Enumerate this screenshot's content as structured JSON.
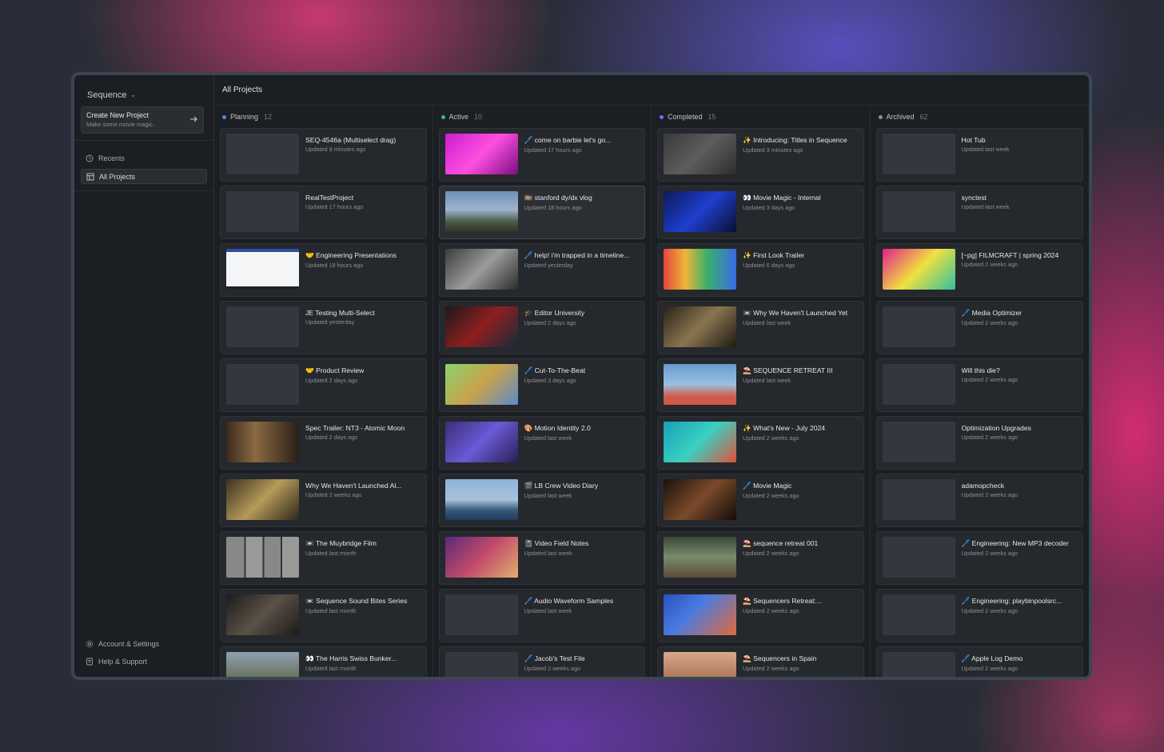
{
  "sidebar": {
    "workspace": "Sequence",
    "create": {
      "title": "Create New Project",
      "subtitle": "Make some movie magic."
    },
    "nav": [
      {
        "label": "Recents",
        "icon": "clock-icon"
      },
      {
        "label": "All Projects",
        "icon": "table-icon"
      }
    ],
    "bottom": [
      {
        "label": "Account & Settings",
        "icon": "gear-icon"
      },
      {
        "label": "Help & Support",
        "icon": "help-icon"
      }
    ]
  },
  "header": {
    "title": "All Projects"
  },
  "columns": [
    {
      "name": "Planning",
      "count": "12",
      "color": "#4a8ef0",
      "cards": [
        {
          "title": "SEQ-4546a (Multiselect drag)",
          "updated": "Updated 9 minutes ago",
          "thumb": ""
        },
        {
          "title": "RealTestProject",
          "updated": "Updated 17 hours ago",
          "thumb": ""
        },
        {
          "title": "🤝 Engineering Presentations",
          "updated": "Updated 18 hours ago",
          "thumb": "linear-gradient(180deg,#2f4ea0 0 8%,#f4f5f7 8% 92%,#222 92%)"
        },
        {
          "title": "JE Testing Multi-Select",
          "updated": "Updated yesterday",
          "thumb": ""
        },
        {
          "title": "🤝 Product Review",
          "updated": "Updated 2 days ago",
          "thumb": ""
        },
        {
          "title": "Spec Trailer: NT3 - Atomic Moon",
          "updated": "Updated 2 days ago",
          "thumb": "linear-gradient(90deg,#3b2a1d,#8a6a42 40%,#2b1f17)"
        },
        {
          "title": "Why We Haven't Launched Al...",
          "updated": "Updated 2 weeks ago",
          "thumb": "linear-gradient(135deg,#3a3120,#b79a5a 50%,#2d261a)"
        },
        {
          "title": "📼 The Muybridge Film",
          "updated": "Updated last month",
          "thumb": "linear-gradient(90deg,#888 0 25%,#333 25% 27%,#999 27% 50%,#333 50% 52%,#888 52% 75%,#333 75% 77%,#999 77%)"
        },
        {
          "title": "📼 Sequence Sound Bites Series",
          "updated": "Updated last month",
          "thumb": "linear-gradient(135deg,#1d1c1a,#5a5147 50%,#1c1b19)"
        },
        {
          "title": "👀 The Harris Swiss Bunker...",
          "updated": "Updated last month",
          "thumb": "linear-gradient(180deg,#8fa0b3,#6b7560 60%,#4b4f3e)"
        }
      ]
    },
    {
      "name": "Active",
      "count": "10",
      "color": "#3dbf6a",
      "cards": [
        {
          "title": "🖊️ come on barbie let's go...",
          "updated": "Updated 17 hours ago",
          "thumb": "linear-gradient(135deg,#c81ecf,#ff4fe0 50%,#7a0f82)"
        },
        {
          "title": "🎞️ stanford dy/dx vlog",
          "updated": "Updated 18 hours ago",
          "thumb": "linear-gradient(180deg,#6f8fb5,#9db5cf 45%,#4b5a48 75%,#2e3328)"
        },
        {
          "title": "🖊️ help! i'm trapped in a timeline...",
          "updated": "Updated yesterday",
          "thumb": "linear-gradient(135deg,#3c3c3c,#9b9b9b 50%,#2b2b2b)"
        },
        {
          "title": "🎓 Editor University",
          "updated": "Updated 2 days ago",
          "thumb": "linear-gradient(135deg,#1a1a1a,#8d1f1f 50%,#1b2a3a)"
        },
        {
          "title": "🖊️ Cut-To-The-Beat",
          "updated": "Updated 3 days ago",
          "thumb": "linear-gradient(135deg,#8ad26f,#c9a24c 50%,#5a8ac8)"
        },
        {
          "title": "🎨 Motion Identity 2.0",
          "updated": "Updated last week",
          "thumb": "linear-gradient(135deg,#3b2d7a,#6a5ad6 50%,#2a1f55)"
        },
        {
          "title": "🎬 LB Crew Video Diary",
          "updated": "Updated last week",
          "thumb": "linear-gradient(180deg,#8fb2d9,#a9c3de 50%,#3a5a7a 75%,#1e3b5a)"
        },
        {
          "title": "📓 Video Field Notes",
          "updated": "Updated last week",
          "thumb": "linear-gradient(135deg,#5a2a7a,#c34a6a 50%,#e0b070)"
        },
        {
          "title": "🖊️ Audio Waveform Samples",
          "updated": "Updated last week",
          "thumb": ""
        },
        {
          "title": "🖊️ Jacob's Test File",
          "updated": "Updated 2 weeks ago",
          "thumb": ""
        }
      ]
    },
    {
      "name": "Completed",
      "count": "15",
      "color": "#7b6cf0",
      "cards": [
        {
          "title": "✨ Introducing: Titles in Sequence",
          "updated": "Updated 3 minutes ago",
          "thumb": "linear-gradient(135deg,#3a3a3a,#5d5d5d 50%,#2d2d2d)"
        },
        {
          "title": "👀 Movie Magic - Internal",
          "updated": "Updated 3 days ago",
          "thumb": "linear-gradient(135deg,#0b1a5a,#1e3fcf 50%,#0a0f2e)"
        },
        {
          "title": "✨ First Look Trailer",
          "updated": "Updated 6 days ago",
          "thumb": "linear-gradient(90deg,#e6453a,#f0b43a 30%,#3ab06a 60%,#3a6ae6)"
        },
        {
          "title": "📼 Why We Haven't Launched Yet",
          "updated": "Updated last week",
          "thumb": "linear-gradient(135deg,#2a2318,#8a7550 50%,#1e1a12)"
        },
        {
          "title": "⛱️ SEQUENCE RETREAT III",
          "updated": "Updated last week",
          "thumb": "linear-gradient(180deg,#6a9ad0,#9ac0e0 50%,#d05a4a 80%)"
        },
        {
          "title": "✨ What's New - July 2024",
          "updated": "Updated 2 weeks ago",
          "thumb": "linear-gradient(135deg,#1aa0b8,#3ad0c0 50%,#e0503a)"
        },
        {
          "title": "🖊️ Movie Magic",
          "updated": "Updated 2 weeks ago",
          "thumb": "linear-gradient(135deg,#1a120c,#7a4a2a 50%,#120c08)"
        },
        {
          "title": "⛱️ sequence retreat 001",
          "updated": "Updated 2 weeks ago",
          "thumb": "linear-gradient(180deg,#3a4a3a,#7a8a6a 50%,#5a4a3a)"
        },
        {
          "title": "⛱️ Sequencers Retreat:...",
          "updated": "Updated 2 weeks ago",
          "thumb": "linear-gradient(135deg,#2a50c0,#4a7ae0 40%,#e06a3a)"
        },
        {
          "title": "⛱️ Sequencers in Spain",
          "updated": "Updated 2 weeks ago",
          "thumb": "linear-gradient(180deg,#d8a88a,#b07a5a 60%,#5a3a2a)"
        }
      ]
    },
    {
      "name": "Archived",
      "count": "62",
      "color": "#8a8f96",
      "cards": [
        {
          "title": "Hot Tub",
          "updated": "Updated last week",
          "thumb": ""
        },
        {
          "title": "synctest",
          "updated": "Updated last week",
          "thumb": ""
        },
        {
          "title": "[~pg] FILMCRAFT | spring 2024",
          "updated": "Updated 2 weeks ago",
          "thumb": "linear-gradient(135deg,#e0208a,#f0e040 50%,#30c0a0)"
        },
        {
          "title": "🖊️ Media Optimizer",
          "updated": "Updated 2 weeks ago",
          "thumb": ""
        },
        {
          "title": "Will this die?",
          "updated": "Updated 2 weeks ago",
          "thumb": ""
        },
        {
          "title": "Optimization Upgrades",
          "updated": "Updated 2 weeks ago",
          "thumb": ""
        },
        {
          "title": "adamopcheck",
          "updated": "Updated 2 weeks ago",
          "thumb": ""
        },
        {
          "title": "🖊️ Engineering: New MP3 decoder",
          "updated": "Updated 2 weeks ago",
          "thumb": ""
        },
        {
          "title": "🖊️ Engineering: playbinpoolsrc...",
          "updated": "Updated 2 weeks ago",
          "thumb": ""
        },
        {
          "title": "🖊️ Apple Log Demo",
          "updated": "Updated 2 weeks ago",
          "thumb": ""
        }
      ]
    }
  ]
}
